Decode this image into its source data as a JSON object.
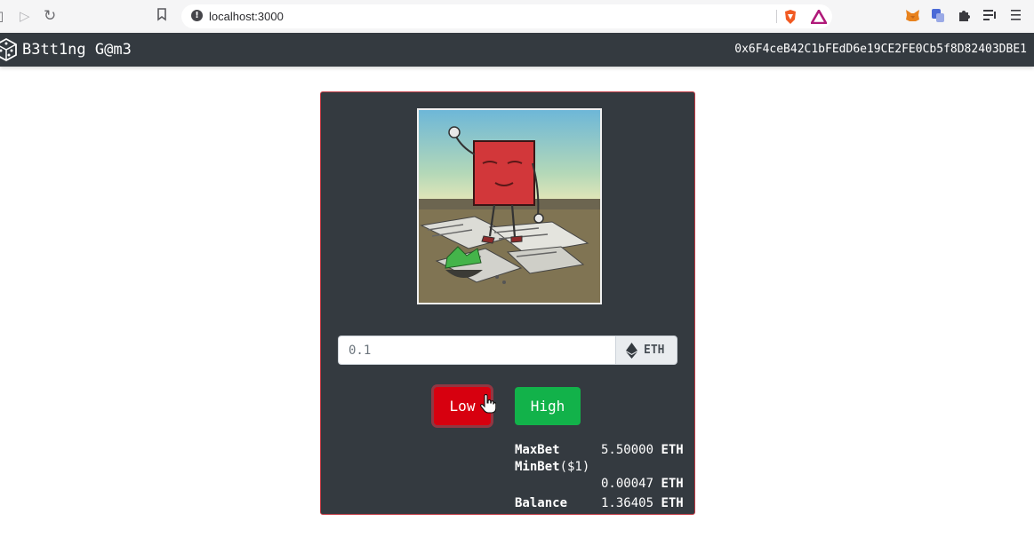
{
  "browser": {
    "url": "localhost:3000",
    "icons": {
      "back": "back-arrow-icon",
      "forward": "forward-arrow-icon",
      "reload": "reload-icon",
      "bookmark": "bookmark-icon",
      "site_info": "info-icon",
      "brave": "brave-shield-icon",
      "rewards": "brave-rewards-icon",
      "metamask": "metamask-fox-icon",
      "translate": "translate-icon",
      "extensions": "puzzle-icon",
      "playlist": "playlist-icon",
      "menu": "hamburger-menu-icon"
    }
  },
  "app": {
    "brand": "B3tt1ng G@m3",
    "account_address": "0x6F4ceB42C1bFEdD6e19CE2FE0Cb5f8D82403DBE1",
    "logo_icon": "dice-icon"
  },
  "game": {
    "bet_amount": "0.1",
    "currency_label": "ETH",
    "currency_icon": "ethereum-icon",
    "low_label": "Low",
    "high_label": "High",
    "stats": {
      "max_bet_label": "MaxBet",
      "max_bet_value": "5.50000",
      "min_bet_label": "MinBet",
      "min_bet_suffix": "($1)",
      "min_bet_value": "0.00047",
      "balance_label": "Balance",
      "balance_value": "1.36405",
      "unit": "ETH"
    }
  },
  "colors": {
    "navbar": "#343a40",
    "card": "#343a40",
    "low_button": "#d7000f",
    "high_button": "#12b24a",
    "card_border": "#c13a44"
  }
}
